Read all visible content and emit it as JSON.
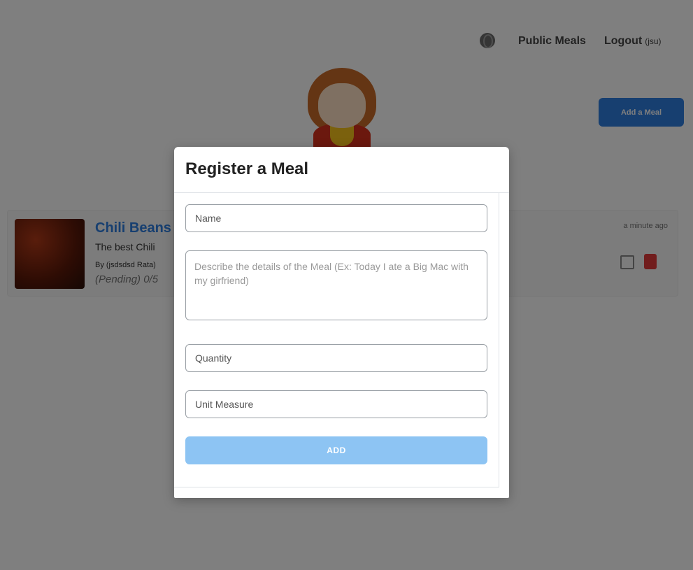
{
  "nav": {
    "public_meals": "Public Meals",
    "logout": "Logout",
    "user": "(jsu)"
  },
  "add_meal_button": "Add a Meal",
  "meal_card": {
    "title": "Chili Beans",
    "description": "The best Chili",
    "author": "By (jsdsdsd Rata)",
    "rating": "(Pending) 0/5",
    "time": "a minute ago"
  },
  "modal": {
    "title": "Register a Meal",
    "name_placeholder": "Name",
    "description_placeholder": "Describe the details of the Meal (Ex: Today I ate a Big Mac with my girfriend)",
    "quantity_placeholder": "Quantity",
    "unit_placeholder": "Unit Measure",
    "add_label": "ADD"
  },
  "colors": {
    "primary": "#2f7fe0",
    "add_button_disabled": "#8dc4f3",
    "overlay": "rgba(0,0,0,0.5)"
  }
}
